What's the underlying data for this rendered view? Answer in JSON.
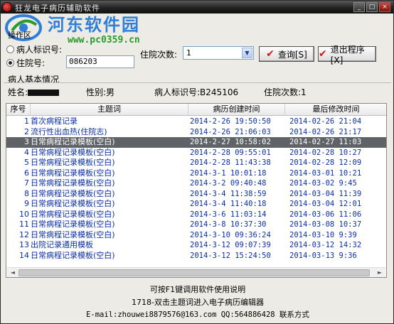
{
  "window": {
    "title": "狂龙电子病历辅助软件",
    "minimize": "_",
    "maximize": "□",
    "close": "×"
  },
  "watermark": {
    "site_name": "河东软件园",
    "url": "www.pc0359.cn"
  },
  "query": {
    "group_label": "操作区",
    "radio_patient_id": "病人标识号:",
    "radio_admission_no": "住院号:",
    "selected_radio": "admission_no",
    "admission_no_value": "086203",
    "visit_count_label": "住院次数:",
    "visit_count_value": "1",
    "search_button": "查询[S]",
    "exit_button": "退出程序[X]"
  },
  "patient": {
    "section_title": "病人基本情况",
    "name_label": "姓名:",
    "sex_label": "性别:",
    "sex_value": "男",
    "patient_id_label": "病人标识号:",
    "patient_id_value": "B245106",
    "visit_label": "住院次数:",
    "visit_value": "1"
  },
  "table": {
    "columns": [
      "序号",
      "主题词",
      "病历创建时间",
      "最后修改时间"
    ],
    "selected_index": 2,
    "rows": [
      {
        "no": "1",
        "subject": "首次病程记录",
        "created": "2014-2-26 19:50:50",
        "modified": "2014-02-26 21:04"
      },
      {
        "no": "2",
        "subject": "流行性出血热(住院志)",
        "created": "2014-2-26 21:06:03",
        "modified": "2014-02-26 21:17"
      },
      {
        "no": "3",
        "subject": "日常病程记录模板(空白)",
        "created": "2014-2-27 10:58:02",
        "modified": "2014-02-27 11:03"
      },
      {
        "no": "4",
        "subject": "日常病程记录模板(空白)",
        "created": "2014-2-28 09:55:01",
        "modified": "2014-02-28 10:27"
      },
      {
        "no": "5",
        "subject": "日常病程记录模板(空白)",
        "created": "2014-2-28 11:43:38",
        "modified": "2014-02-28 12:09"
      },
      {
        "no": "6",
        "subject": "日常病程记录模板(空白)",
        "created": "2014-3-1 10:01:18",
        "modified": "2014-03-01 10:21"
      },
      {
        "no": "7",
        "subject": "日常病程记录模板(空白)",
        "created": "2014-3-2 09:40:48",
        "modified": "2014-03-02 9:45"
      },
      {
        "no": "8",
        "subject": "日常病程记录模板(空白)",
        "created": "2014-3-4 11:38:59",
        "modified": "2014-03-04 11:39"
      },
      {
        "no": "9",
        "subject": "日常病程记录模板(空白)",
        "created": "2014-3-4 11:40:18",
        "modified": "2014-03-04 12:01"
      },
      {
        "no": "10",
        "subject": "日常病程记录模板(空白)",
        "created": "2014-3-6 11:03:14",
        "modified": "2014-03-06 11:06"
      },
      {
        "no": "11",
        "subject": "日常病程记录模板(空白)",
        "created": "2014-3-8 10:37:30",
        "modified": "2014-03-08 10:37"
      },
      {
        "no": "12",
        "subject": "日常病程记录模板(空白)",
        "created": "2014-3-10 09:36:24",
        "modified": "2014-03-10 9:39"
      },
      {
        "no": "13",
        "subject": "出院记录通用模板",
        "created": "2014-3-12 09:07:39",
        "modified": "2014-03-12 14:32"
      },
      {
        "no": "14",
        "subject": "日常病程记录模板(空白)",
        "created": "2014-3-12 15:24:50",
        "modified": "2014-03-13 9:36"
      }
    ]
  },
  "footer": {
    "line1": "可按F1键调用软件使用说明",
    "line2": "1718-双击主题词进入电子病历编辑器",
    "line3": "E-mail:zhouwei8879576@163.com QQ:564886428 联系方式"
  },
  "colors": {
    "title_bar": "#222222",
    "link_text": "#0a2fa8",
    "selected_row": "#5f6266",
    "watermark_blue": "#2f7fd9",
    "watermark_green": "#2a9a2a",
    "button_check": "#c81a1a"
  },
  "icons": {
    "app": "app-icon",
    "search_button": "check-icon",
    "exit_button": "check-icon"
  }
}
